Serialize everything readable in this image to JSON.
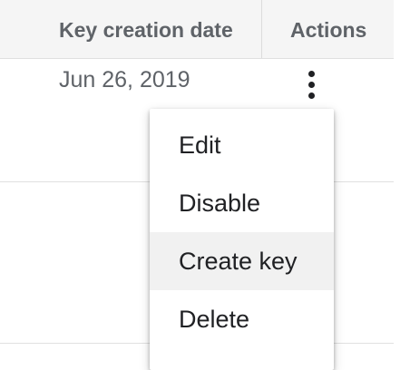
{
  "table": {
    "columns": [
      {
        "label": "Key creation date"
      },
      {
        "label": "Actions"
      }
    ],
    "rows": [
      {
        "key_creation_date": "Jun 26, 2019"
      }
    ]
  },
  "menu": {
    "items": [
      {
        "label": "Edit",
        "highlighted": false
      },
      {
        "label": "Disable",
        "highlighted": false
      },
      {
        "label": "Create key",
        "highlighted": true
      },
      {
        "label": "Delete",
        "highlighted": false
      }
    ]
  },
  "icons": {
    "row_actions": "more-vert-icon"
  },
  "colors": {
    "header_bg": "#f5f5f5",
    "header_text": "#5f6368",
    "cell_text": "#5f6368",
    "menu_text": "#202124",
    "menu_highlight": "#f1f1f1",
    "divider": "#e0e0e0"
  }
}
